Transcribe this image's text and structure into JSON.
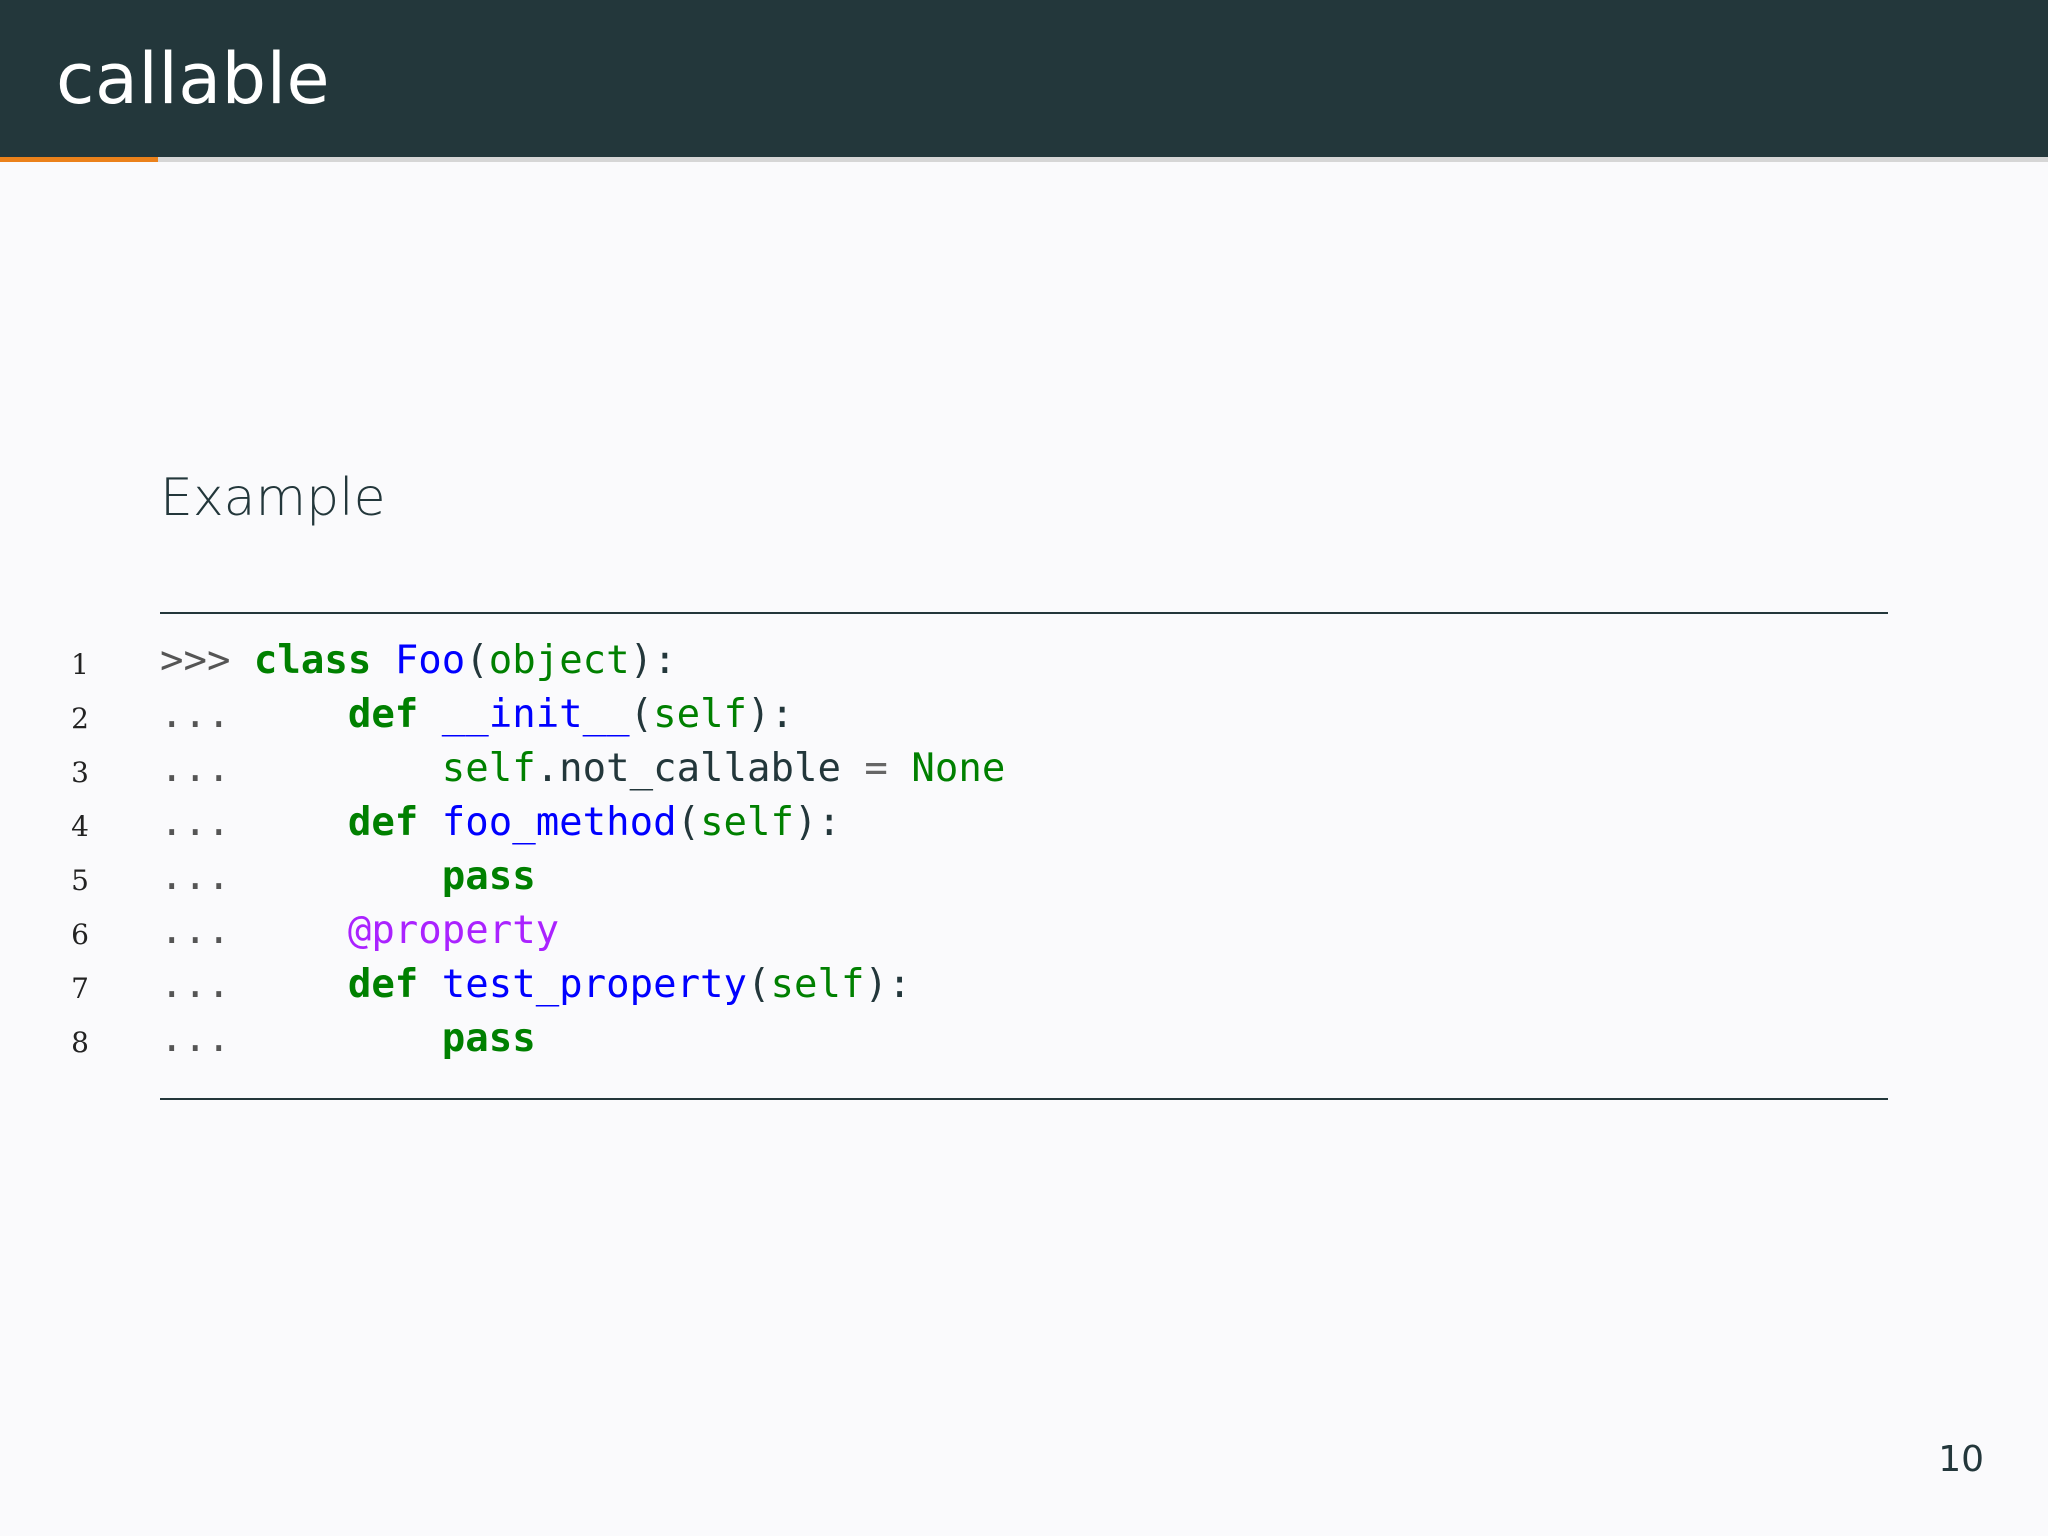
{
  "slide": {
    "title": "callable",
    "progress_fraction": 0.077,
    "section_heading": "Example",
    "page_number": "10"
  },
  "colors": {
    "header_bg": "#23373b",
    "progress_fill": "#eb811b",
    "background": "#fafafc",
    "keyword": "#008000",
    "name": "#0000ff",
    "decorator": "#aa22ff"
  },
  "code": {
    "lines": [
      {
        "number": "1",
        "tokens": [
          {
            "text": ">>> ",
            "type": "prompt"
          },
          {
            "text": "class",
            "type": "kw"
          },
          {
            "text": " ",
            "type": "plain"
          },
          {
            "text": "Foo",
            "type": "name"
          },
          {
            "text": "(",
            "type": "plain"
          },
          {
            "text": "object",
            "type": "builtin"
          },
          {
            "text": "):",
            "type": "plain"
          }
        ]
      },
      {
        "number": "2",
        "tokens": [
          {
            "text": "...     ",
            "type": "prompt"
          },
          {
            "text": "def",
            "type": "kw"
          },
          {
            "text": " ",
            "type": "plain"
          },
          {
            "text": "__init__",
            "type": "name"
          },
          {
            "text": "(",
            "type": "plain"
          },
          {
            "text": "self",
            "type": "builtin"
          },
          {
            "text": "):",
            "type": "plain"
          }
        ]
      },
      {
        "number": "3",
        "tokens": [
          {
            "text": "...         ",
            "type": "prompt"
          },
          {
            "text": "self",
            "type": "builtin"
          },
          {
            "text": ".not_callable ",
            "type": "plain"
          },
          {
            "text": "=",
            "type": "op"
          },
          {
            "text": " ",
            "type": "plain"
          },
          {
            "text": "None",
            "type": "builtin"
          }
        ]
      },
      {
        "number": "4",
        "tokens": [
          {
            "text": "...     ",
            "type": "prompt"
          },
          {
            "text": "def",
            "type": "kw"
          },
          {
            "text": " ",
            "type": "plain"
          },
          {
            "text": "foo_method",
            "type": "name"
          },
          {
            "text": "(",
            "type": "plain"
          },
          {
            "text": "self",
            "type": "builtin"
          },
          {
            "text": "):",
            "type": "plain"
          }
        ]
      },
      {
        "number": "5",
        "tokens": [
          {
            "text": "...         ",
            "type": "prompt"
          },
          {
            "text": "pass",
            "type": "kw"
          }
        ]
      },
      {
        "number": "6",
        "tokens": [
          {
            "text": "...     ",
            "type": "prompt"
          },
          {
            "text": "@property",
            "type": "deco"
          }
        ]
      },
      {
        "number": "7",
        "tokens": [
          {
            "text": "...     ",
            "type": "prompt"
          },
          {
            "text": "def",
            "type": "kw"
          },
          {
            "text": " ",
            "type": "plain"
          },
          {
            "text": "test_property",
            "type": "name"
          },
          {
            "text": "(",
            "type": "plain"
          },
          {
            "text": "self",
            "type": "builtin"
          },
          {
            "text": "):",
            "type": "plain"
          }
        ]
      },
      {
        "number": "8",
        "tokens": [
          {
            "text": "...         ",
            "type": "prompt"
          },
          {
            "text": "pass",
            "type": "kw"
          }
        ]
      }
    ]
  }
}
